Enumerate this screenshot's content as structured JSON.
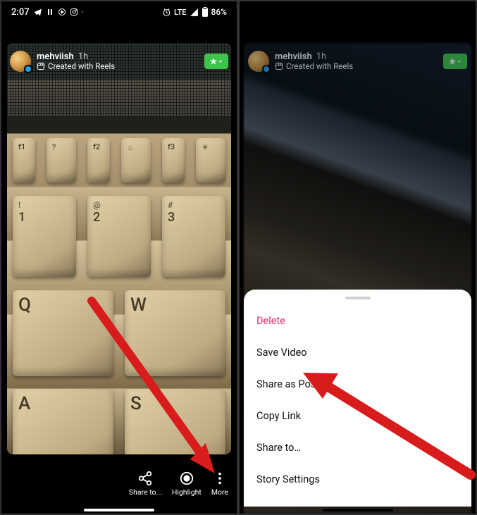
{
  "status": {
    "time": "2:07",
    "network_label": "LTE",
    "battery_text": "86%"
  },
  "user": {
    "username": "mehviish",
    "timestamp": "1h",
    "subtitle": "Created with Reels"
  },
  "left_toolbar": {
    "share": "Share to...",
    "highlight": "Highlight",
    "more": "More"
  },
  "sheet": {
    "delete": "Delete",
    "save_video": "Save Video",
    "share_post": "Share as Post…",
    "copy_link": "Copy Link",
    "share_to": "Share to…",
    "story_settings": "Story Settings"
  },
  "colors": {
    "accent_green": "#3dc44b",
    "destructive": "#e1306c"
  }
}
